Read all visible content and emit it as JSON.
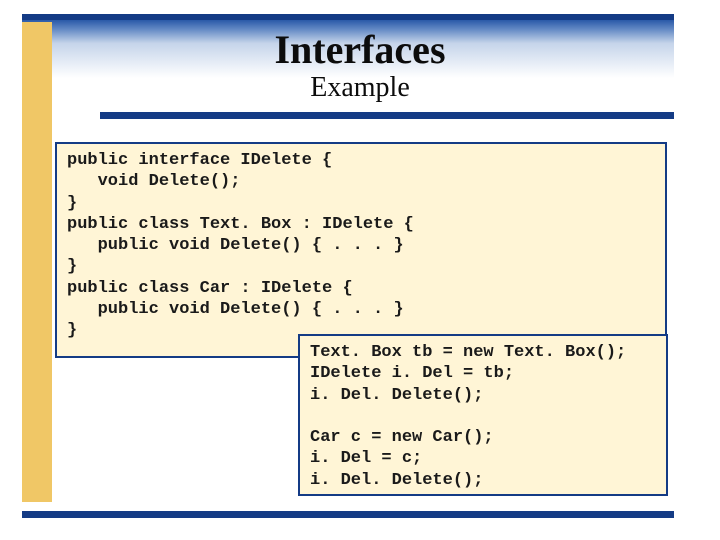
{
  "header": {
    "title": "Interfaces",
    "subtitle": "Example"
  },
  "code": {
    "block1": "public interface IDelete {\n   void Delete();\n}\npublic class Text. Box : IDelete {\n   public void Delete() { . . . }\n}\npublic class Car : IDelete {\n   public void Delete() { . . . }\n}",
    "block2": "Text. Box tb = new Text. Box();\nIDelete i. Del = tb;\ni. Del. Delete();\n\nCar c = new Car();\ni. Del = c;\ni. Del. Delete();"
  }
}
